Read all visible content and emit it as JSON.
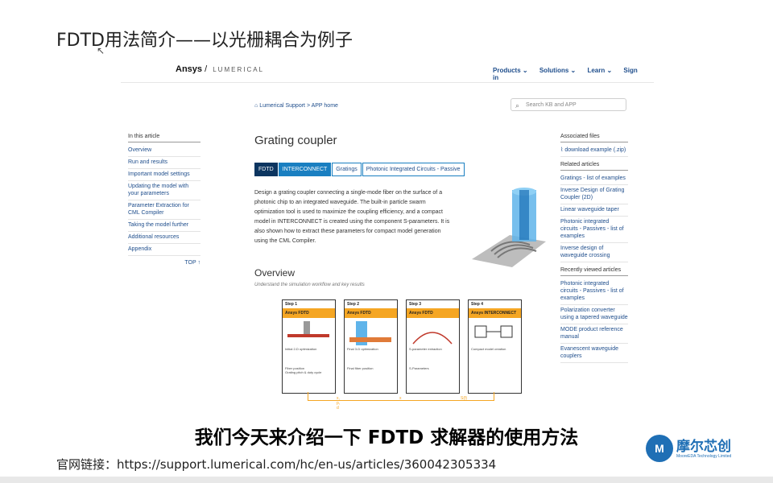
{
  "slide": {
    "title": "FDTD用法简介——以光栅耦合为例子",
    "subtitle": "我们今天来介绍一下 FDTD 求解器的使用方法",
    "link": "官网链接：https://support.lumerical.com/hc/en-us/articles/360042305334"
  },
  "site": {
    "logo_main": "Ansys",
    "logo_sep": "/",
    "logo_sub": "LUMERICAL",
    "nav": [
      "Products ⌄",
      "Solutions ⌄",
      "Learn ⌄",
      "Sign in"
    ],
    "breadcrumb": "Lumerical Support > APP home",
    "search_placeholder": "Search KB and APP"
  },
  "toc": {
    "heading": "In this article",
    "items": [
      "Overview",
      "Run and results",
      "Important model settings",
      "Updating the model with your parameters",
      "Parameter Extraction for CML Compiler",
      "Taking the model further",
      "Additional resources",
      "Appendix"
    ],
    "top_label": "TOP ↑"
  },
  "article": {
    "title": "Grating coupler",
    "tags": [
      "FDTD",
      "INTERCONNECT",
      "Gratings",
      "Photonic Integrated Circuits - Passive"
    ],
    "description": "Design a grating coupler connecting a single-mode fiber on the surface of a photonic chip to an integrated waveguide. The built-in particle swarm optimization tool is used to maximize the coupling efficiency, and a compact model in INTERCONNECT is created using the component S-parameters. It is also shown how to extract these parameters for compact model generation using the CML Compiler.",
    "overview_title": "Overview",
    "overview_sub": "Understand the simulation workflow and key results"
  },
  "workflow": [
    {
      "step": "Step 1",
      "header": "Ansys FDTD",
      "cap1": "Initial 2-D optimization",
      "cap2": "Fiber position\nGrating pitch & duty cycle"
    },
    {
      "step": "Step 2",
      "header": "Ansys FDTD",
      "cap1": "Final 3-D optimization",
      "cap2": "Final fiber position"
    },
    {
      "step": "Step 3",
      "header": "Ansys FDTD",
      "cap1": "S-parameter extraction",
      "cap2": "S-Parameters"
    },
    {
      "step": "Step 4",
      "header": "Ansys INTERCONNECT",
      "cap1": "Compact model creation",
      "cap2": ""
    }
  ],
  "workflow_labels": [
    "x, p, d",
    "x",
    "S(f)"
  ],
  "sidebar": {
    "files_heading": "Associated files",
    "file": "download example (.zip)",
    "related_heading": "Related articles",
    "related": [
      "Gratings - list of examples",
      "Inverse Design of Grating Coupler (2D)",
      "Linear waveguide taper",
      "Photonic integrated circuits - Passives - list of examples",
      "Inverse design of waveguide crossing"
    ],
    "recent_heading": "Recently viewed articles",
    "recent": [
      "Photonic integrated circuits - Passives - list of examples",
      "Polarization converter using a tapered waveguide",
      "MODE product reference manual",
      "Evanescent waveguide couplers"
    ]
  },
  "brand": {
    "name": "摩尔芯创",
    "english": "MooreEDA Technology Limited",
    "mark": "M"
  }
}
